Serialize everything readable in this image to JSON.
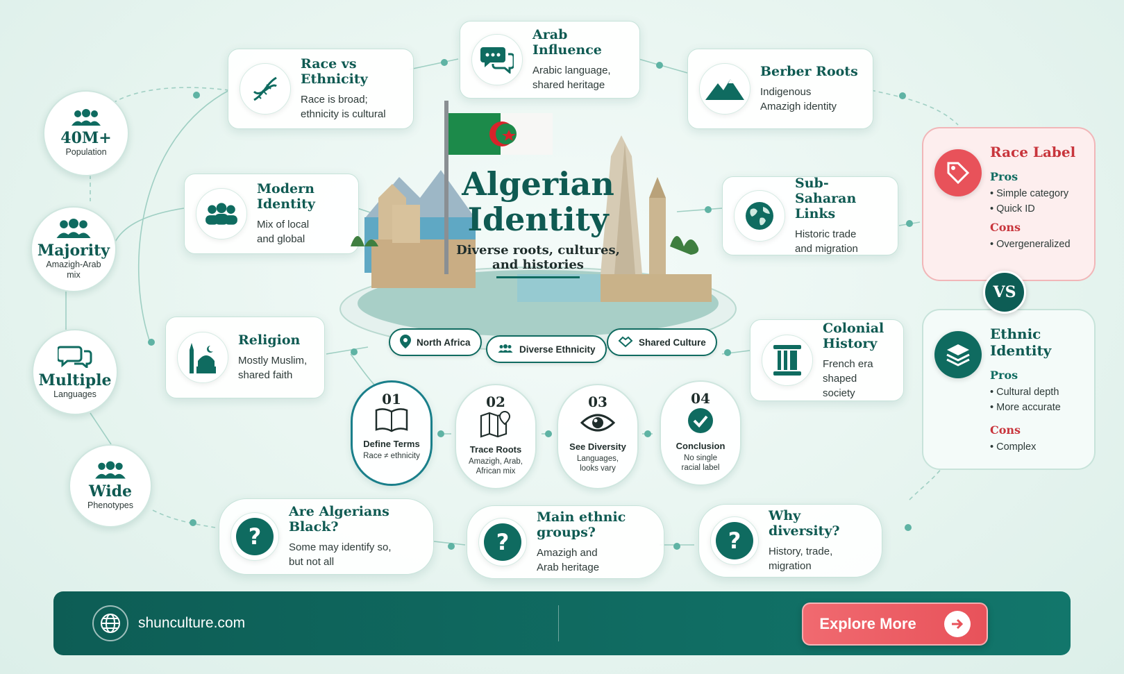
{
  "hero": {
    "title_line1": "Algerian",
    "title_line2": "Identity",
    "subtitle_line1": "Diverse roots, cultures,",
    "subtitle_line2": "and histories",
    "pills": [
      "North Africa",
      "Diverse Ethnicity",
      "Shared Culture"
    ]
  },
  "topics": {
    "race_vs_ethnicity": {
      "title": "Race vs Ethnicity",
      "line1": "Race is broad;",
      "line2": "ethnicity is cultural"
    },
    "arab_influence": {
      "title": "Arab Influence",
      "line1": "Arabic language,",
      "line2": "shared heritage"
    },
    "berber_roots": {
      "title": "Berber Roots",
      "line1": "Indigenous",
      "line2": "Amazigh identity"
    },
    "modern_identity": {
      "title": "Modern Identity",
      "line1": "Mix of local",
      "line2": "and global"
    },
    "sub_saharan": {
      "title": "Sub-Saharan Links",
      "line1": "Historic trade",
      "line2": "and migration"
    },
    "religion": {
      "title": "Religion",
      "line1": "Mostly Muslim,",
      "line2": "shared faith"
    },
    "colonial": {
      "title": "Colonial History",
      "line1": "French era",
      "line2": "shaped society"
    }
  },
  "stats": [
    {
      "big": "40M+",
      "small1": "Population",
      "small2": ""
    },
    {
      "big": "Majority",
      "small1": "Amazigh-Arab",
      "small2": "mix"
    },
    {
      "big": "Multiple",
      "small1": "Languages",
      "small2": ""
    },
    {
      "big": "Wide",
      "small1": "Phenotypes",
      "small2": ""
    }
  ],
  "steps": [
    {
      "num": "01",
      "title": "Define Terms",
      "d1": "Race ≠ ethnicity",
      "d2": ""
    },
    {
      "num": "02",
      "title": "Trace Roots",
      "d1": "Amazigh, Arab,",
      "d2": "African mix"
    },
    {
      "num": "03",
      "title": "See Diversity",
      "d1": "Languages,",
      "d2": "looks vary"
    },
    {
      "num": "04",
      "title": "Conclusion",
      "d1": "No single",
      "d2": "racial label"
    }
  ],
  "faqs": [
    {
      "q": "Are Algerians Black?",
      "a1": "Some may identify so,",
      "a2": "but not all"
    },
    {
      "q": "Main ethnic groups?",
      "a1": "Amazigh and",
      "a2": "Arab heritage"
    },
    {
      "q": "Why diversity?",
      "a1": "History, trade,",
      "a2": "migration"
    }
  ],
  "compare": {
    "race": {
      "title": "Race Label",
      "pros_label": "Pros",
      "pros": [
        "Simple category",
        "Quick ID"
      ],
      "cons_label": "Cons",
      "cons": [
        "Overgeneralized"
      ]
    },
    "vs": "VS",
    "ethnic": {
      "title": "Ethnic Identity",
      "pros_label": "Pros",
      "pros": [
        "Cultural depth",
        "More accurate"
      ],
      "cons_label": "Cons",
      "cons": [
        "Complex"
      ]
    }
  },
  "footer": {
    "site": "shunculture.com",
    "cta": "Explore More"
  },
  "colors": {
    "teal": "#0f6b60",
    "dark_teal": "#0d5d55",
    "red": "#e8525a",
    "pink_bg": "#fdeeee"
  }
}
